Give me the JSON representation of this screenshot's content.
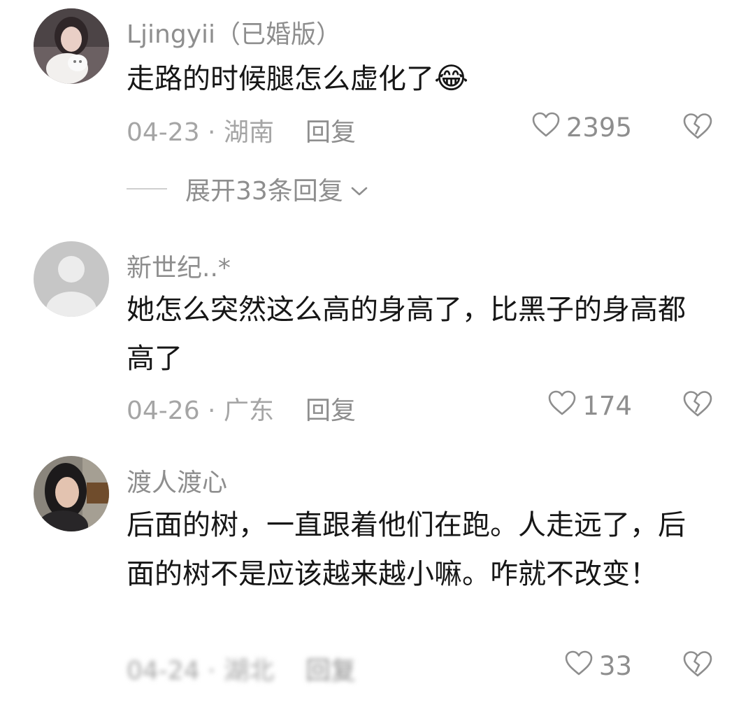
{
  "comments": [
    {
      "username": "Ljingyii（已婚版）",
      "text": "走路的时候腿怎么虚化了",
      "emoji": "😂",
      "date": "04-23",
      "location": "湖南",
      "reply_label": "回复",
      "likes": "2395",
      "expand_label": "展开33条回复"
    },
    {
      "username": "新世纪..*",
      "text": "她怎么突然这么高的身高了，比黑子的身高都高了",
      "date": "04-26",
      "location": "广东",
      "reply_label": "回复",
      "likes": "174"
    },
    {
      "username": "渡人渡心",
      "text": "后面的树，一直跟着他们在跑。人走远了，后面的树不是应该越来越小嘛。咋就不改变！",
      "date": "04-24",
      "location": "湖北",
      "reply_label": "回复",
      "likes": "33"
    }
  ],
  "meta_separator": " · ",
  "icons": {
    "like": "heart-outline-icon",
    "dislike": "broken-heart-icon",
    "expand": "chevron-down-icon"
  },
  "colors": {
    "text": "#161616",
    "secondary": "#8e8e8e",
    "tertiary": "#a5a5a5"
  }
}
